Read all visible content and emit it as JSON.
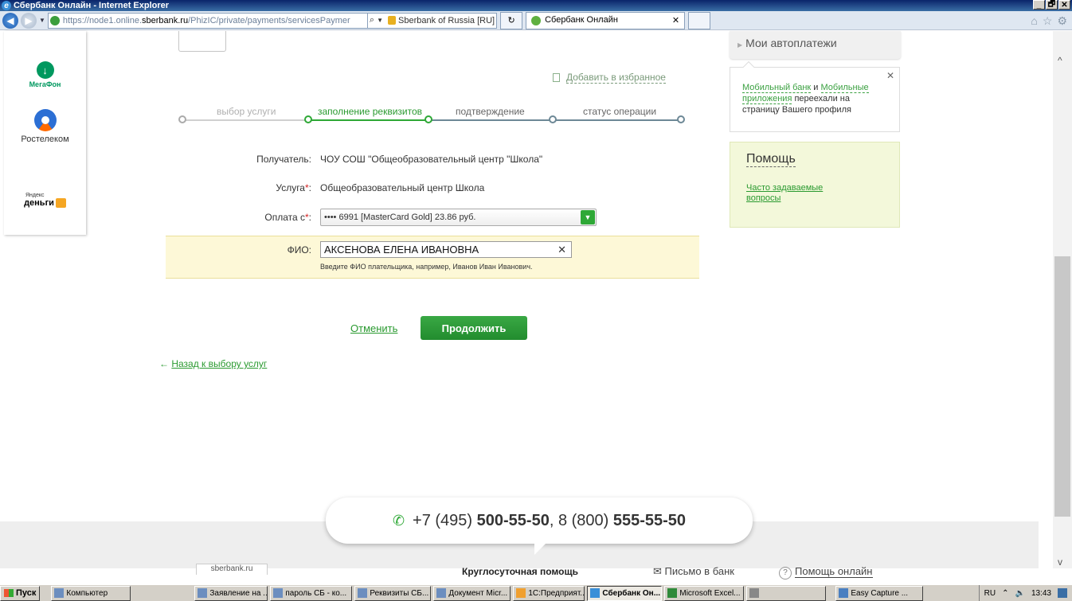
{
  "window": {
    "title": "Сбербанк Онлайн - Internet Explorer",
    "controls": [
      "_",
      "🗗",
      "✕"
    ]
  },
  "browser": {
    "url_prefix": "https://node1.online.",
    "url_domain": "sberbank.ru",
    "url_path": "/PhizIC/private/payments/servicesPaymer",
    "cert_label": "Sberbank of Russia [RU]",
    "tab_title": "Сбербанк Онлайн"
  },
  "sidebar": {
    "megafon": "МегаФон",
    "rostelecom": "Ростелеком",
    "yandex_small": "Яндекс",
    "yandex_money": "деньги"
  },
  "favorites": {
    "label": "Добавить в избранное"
  },
  "steps": [
    {
      "label": "выбор услуги",
      "state": "done"
    },
    {
      "label": "заполнение реквизитов",
      "state": "active"
    },
    {
      "label": "подтверждение",
      "state": "pending"
    },
    {
      "label": "статус операции",
      "state": "pending"
    }
  ],
  "form": {
    "recipient_label": "Получатель:",
    "recipient_value": "ЧОУ СОШ \"Общеобразовательный центр \"Школа\"",
    "service_label": "Услуга",
    "service_value": "Общеобразовательный центр Школа",
    "payment_label": "Оплата с",
    "payment_value": "•••• 6991 [MasterCard Gold] 23.86 руб.",
    "required_mark": "*",
    "colon": ":",
    "fio_label": "ФИО:",
    "fio_value": "АКСЕНОВА ЕЛЕНА ИВАНОВНА",
    "fio_hint": "Введите ФИО плательщика, например, Иванов Иван Иванович."
  },
  "actions": {
    "cancel": "Отменить",
    "continue": "Продолжить",
    "back": "Назад к выбору услуг"
  },
  "right": {
    "autopay": "Мои автоплатежи",
    "notice_link1": "Мобильный банк",
    "notice_and": " и ",
    "notice_link2": "Мобильные приложения",
    "notice_rest": " переехали на страницу Вашего профиля",
    "help_title": "Помощь",
    "help_faq": "Часто задаваемые вопросы"
  },
  "footer": {
    "phone1_prefix": "+7 (495) ",
    "phone1_bold": "500-55-50",
    "separator": ", 8 (800) ",
    "phone2_bold": "555-55-50",
    "site_tab": "sberbank.ru",
    "help_24": "Круглосуточная помощь",
    "mail_bank": "Письмо в банк",
    "help_online": "Помощь онлайн"
  },
  "taskbar": {
    "start": "Пуск",
    "items": [
      {
        "label": "Компьютер",
        "active": false
      },
      {
        "label": "Заявление на ...",
        "active": false
      },
      {
        "label": "пароль СБ - ко...",
        "active": false
      },
      {
        "label": "Реквизиты СБ...",
        "active": false
      },
      {
        "label": "Документ Micr...",
        "active": false
      },
      {
        "label": "1С:Предприят...",
        "active": false
      },
      {
        "label": "Сбербанк Он...",
        "active": true
      },
      {
        "label": "Microsoft Excel...",
        "active": false
      },
      {
        "label": "",
        "active": false
      },
      {
        "label": "Easy Capture ...",
        "active": false
      }
    ],
    "lang": "RU",
    "time": "13:43"
  }
}
